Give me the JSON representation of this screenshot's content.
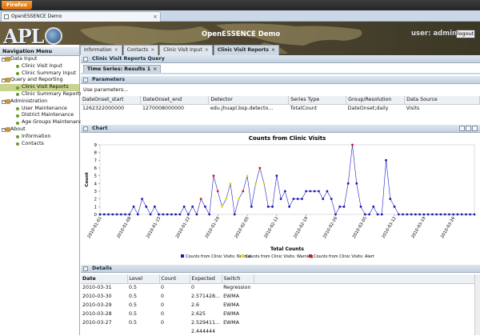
{
  "browser": {
    "menu_button": "Firefox",
    "tab_title": "OpenESSENCE Demo"
  },
  "header": {
    "logo_text": "APL",
    "app_title": "OpenESSENCE Demo",
    "user_prefix": "user:",
    "user_name": "admin",
    "logout_label": "logout"
  },
  "app_tabs": [
    {
      "label": "Information"
    },
    {
      "label": "Contacts"
    },
    {
      "label": "Clinic Visit Input"
    },
    {
      "label": "Clinic Visit Reports",
      "active": true
    }
  ],
  "nav": {
    "title": "Navigation Menu",
    "items": [
      {
        "label": "Data Input",
        "kind": "group"
      },
      {
        "label": "Clinic Visit Input",
        "kind": "leaf"
      },
      {
        "label": "Clinic Summary Input",
        "kind": "leaf"
      },
      {
        "label": "Query and Reporting",
        "kind": "group"
      },
      {
        "label": "Clinic Visit Reports",
        "kind": "leaf",
        "selected": true
      },
      {
        "label": "Clinic Summary Reports",
        "kind": "leaf"
      },
      {
        "label": "Administration",
        "kind": "group"
      },
      {
        "label": "User Maintenance",
        "kind": "leaf"
      },
      {
        "label": "District Maintenance",
        "kind": "leaf"
      },
      {
        "label": "Age Groups Maintenance",
        "kind": "leaf"
      },
      {
        "label": "About",
        "kind": "group"
      },
      {
        "label": "Information",
        "kind": "leaf"
      },
      {
        "label": "Contacts",
        "kind": "leaf"
      }
    ]
  },
  "query_panel": {
    "title": "Clinic Visit Reports Query",
    "result_tab": "Time Series: Results 1",
    "params_title": "Parameters",
    "params_text": "Use parameters...",
    "columns": [
      "DateOnset_start",
      "DateOnset_end",
      "Detector",
      "Series Type",
      "Group/Resolution",
      "Data Source"
    ],
    "row": [
      "1262322000000",
      "1270008000000",
      "edu.jhuapl.bsp.detecto...",
      "TotalCount",
      "DateOnset;daily",
      "Visits"
    ]
  },
  "chart_panel": {
    "title": "Chart"
  },
  "chart_data": {
    "type": "line",
    "title": "Counts from Clinic Visits",
    "xlabel": "Total Counts",
    "ylabel": "Count",
    "ylim": [
      0,
      9
    ],
    "yticks": [
      0,
      1,
      2,
      3,
      4,
      5,
      6,
      7,
      8,
      9
    ],
    "xtick_labels": [
      "2010-01-01",
      "2010-01-08",
      "2010-01-15",
      "2010-01-22",
      "2010-01-29",
      "2010-02-05",
      "2010-02-12",
      "2010-02-19",
      "2010-02-26",
      "2010-03-05",
      "2010-03-12",
      "2010-03-19",
      "2010-03-26"
    ],
    "start_label": "2010-01-01",
    "values": [
      0,
      0,
      0,
      0,
      0,
      0,
      0,
      0,
      1,
      0,
      2,
      1,
      0,
      1,
      0,
      0,
      0,
      0,
      0,
      0,
      1,
      0,
      1,
      0,
      2,
      1,
      0,
      5,
      3,
      1,
      2,
      4,
      0,
      2,
      3,
      5,
      1,
      4,
      6,
      4,
      1,
      1,
      5,
      2,
      3,
      1,
      2,
      2,
      2,
      3,
      3,
      3,
      3,
      2,
      3,
      2,
      0,
      1,
      1,
      4,
      9,
      4,
      1,
      0,
      0,
      1,
      0,
      0,
      7,
      2,
      1,
      0,
      0,
      0,
      0,
      0,
      0,
      0,
      0,
      0,
      0,
      0,
      0,
      0,
      0,
      0,
      0,
      0,
      0,
      0
    ],
    "status": [
      "n",
      "n",
      "n",
      "n",
      "n",
      "n",
      "n",
      "n",
      "n",
      "n",
      "n",
      "n",
      "n",
      "n",
      "n",
      "n",
      "n",
      "n",
      "n",
      "n",
      "n",
      "n",
      "n",
      "n",
      "a",
      "n",
      "n",
      "a",
      "a",
      "w",
      "w",
      "w",
      "n",
      "w",
      "a",
      "w",
      "n",
      "w",
      "a",
      "w",
      "n",
      "n",
      "n",
      "n",
      "n",
      "n",
      "n",
      "n",
      "n",
      "n",
      "n",
      "n",
      "n",
      "n",
      "n",
      "n",
      "n",
      "n",
      "n",
      "n",
      "a",
      "n",
      "n",
      "n",
      "n",
      "n",
      "n",
      "n",
      "n",
      "n",
      "n",
      "n",
      "n",
      "n",
      "n",
      "n",
      "n",
      "n",
      "n",
      "n",
      "n",
      "n",
      "n",
      "n",
      "n",
      "n",
      "n",
      "n",
      "n",
      "n"
    ],
    "legend": [
      {
        "name": "Counts from Clinic Visits: Normal",
        "status": "n"
      },
      {
        "name": "Counts from Clinic Visits: Warning",
        "status": "w"
      },
      {
        "name": "Counts from Clinic Visits: Alert",
        "status": "a"
      }
    ],
    "colors": {
      "line": "#2020c0",
      "n": "#1c1ca8",
      "w": "#f0e000",
      "a": "#e01010"
    },
    "legend_placement": "bottom"
  },
  "details": {
    "title": "Details",
    "columns": [
      "Date",
      "Level",
      "Count",
      "Expected",
      "Switch"
    ],
    "rows": [
      [
        "2010-03-31",
        "0.5",
        "0",
        "0",
        "Regression"
      ],
      [
        "2010-03-30",
        "0.5",
        "0",
        "2.571428...",
        "EWMA"
      ],
      [
        "2010-03-29",
        "0.5",
        "0",
        "2.6",
        "EWMA"
      ],
      [
        "2010-03-28",
        "0.5",
        "0",
        "2.625",
        "EWMA"
      ],
      [
        "2010-03-27",
        "0.5",
        "0",
        "2.529411...",
        "EWMA"
      ],
      [
        "",
        "",
        "",
        "2.444444",
        ""
      ]
    ]
  }
}
